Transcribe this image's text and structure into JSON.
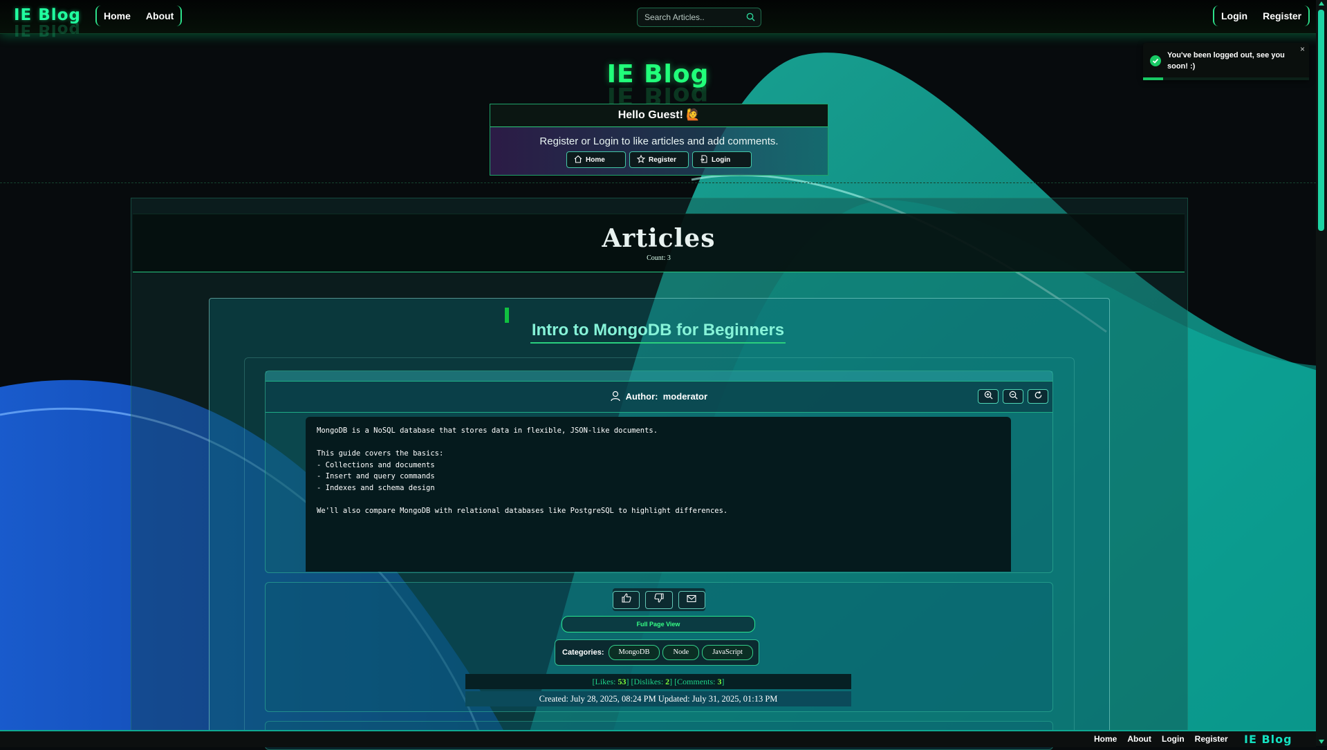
{
  "app": {
    "brand": "IE Blog",
    "nav": {
      "home": "Home",
      "about": "About"
    },
    "auth": {
      "login": "Login",
      "register": "Register"
    },
    "search": {
      "placeholder": "Search Articles.."
    }
  },
  "toast": {
    "message": "You've been logged out, see you soon! :)",
    "close": "×",
    "progress_fraction": 0.12
  },
  "hero": {
    "title": "IE Blog",
    "greeting": "Hello Guest! 🙋",
    "message": "Register or Login to like articles and add comments.",
    "buttons": {
      "home": "Home",
      "register": "Register",
      "login": "Login"
    }
  },
  "articles": {
    "title": "Articles",
    "count": "Count: 3"
  },
  "article": {
    "title": "Intro to MongoDB for Beginners",
    "author_label": "Author:",
    "author": "moderator",
    "content": "MongoDB is a NoSQL database that stores data in flexible, JSON-like documents.\n\nThis guide covers the basics:\n- Collections and documents\n- Insert and query commands\n- Indexes and schema design\n\nWe'll also compare MongoDB with relational databases like PostgreSQL to highlight differences.",
    "full_page_view": "Full Page View",
    "categories_label": "Categories:",
    "categories": [
      "MongoDB",
      "Node",
      "JavaScript"
    ],
    "stats": {
      "likes_label": "[Likes:",
      "likes": "53",
      "dislikes_label": "] [Dislikes:",
      "dislikes": "2",
      "comments_label": "] [Comments:",
      "comments": "3",
      "close": "]"
    },
    "dates": "Created: July 28, 2025, 08:24 PM  Updated: July 31, 2025, 01:13 PM"
  },
  "footer": {
    "links": [
      "Home",
      "About",
      "Login",
      "Register"
    ],
    "brand": "IE Blog"
  },
  "colors": {
    "accent": "#21ff7a",
    "brand": "#21ffa0",
    "teal": "#0fa892"
  }
}
